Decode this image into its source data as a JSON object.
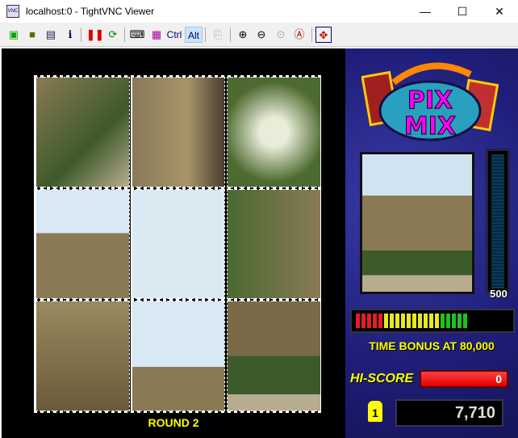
{
  "window": {
    "title": "localhost:0 - TightVNC Viewer",
    "app_icon": "VNC"
  },
  "toolbar": {
    "ctrl": "Ctrl",
    "alt": "Alt"
  },
  "game": {
    "round": "ROUND 2",
    "logo": "PIX MIX",
    "meter_value": "500",
    "bonus_text": "TIME BONUS AT 80,000",
    "hiscore_label": "HI-SCORE",
    "hiscore": "0",
    "player": "1",
    "score": "7,710",
    "bonus_segments": {
      "red": 5,
      "yellow": 10,
      "green": 5,
      "total": 30
    },
    "colors": {
      "panel": "#1e1e78",
      "accent": "#ffff00",
      "hiscore_bar": "#e00000"
    }
  }
}
